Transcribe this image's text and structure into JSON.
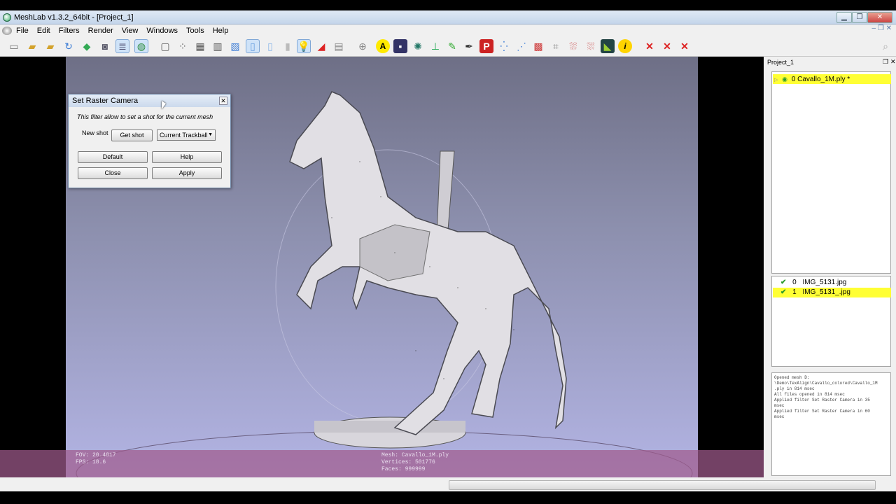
{
  "window": {
    "title": "MeshLab v1.3.2_64bit - [Project_1]"
  },
  "menu": [
    "File",
    "Edit",
    "Filters",
    "Render",
    "View",
    "Windows",
    "Tools",
    "Help"
  ],
  "dialog": {
    "title": "Set Raster Camera",
    "description": "This filter allow to set a shot for the current mesh",
    "new_shot_label": "New shot",
    "get_shot_label": "Get shot",
    "combo_value": "Current Trackball",
    "default_label": "Default",
    "help_label": "Help",
    "close_label": "Close",
    "apply_label": "Apply"
  },
  "viewport": {
    "fov": "FOV: 20.4817",
    "fps": "FPS:   18.6",
    "mesh": "Mesh: Cavallo_1M.ply",
    "vertices": "Vertices: 501776",
    "faces": "Faces: 999999"
  },
  "panel": {
    "title": "Project_1",
    "layers": [
      {
        "label": "0  Cavallo_1M.ply *",
        "selected": true
      }
    ],
    "rasters": [
      {
        "index": "0",
        "name": "IMG_5131.jpg",
        "selected": false
      },
      {
        "index": "1",
        "name": "IMG_5131_.jpg",
        "selected": true
      }
    ],
    "log": [
      "Opened mesh D:",
      "\\Demo\\TexAlign\\Cavallo_colored\\Cavallo_1M",
      ".ply in 814 msec",
      "All files opened in 814 msec",
      "Applied filter Set Raster Camera in 35",
      "msec",
      "Applied filter Set Raster Camera in 60",
      "msec"
    ]
  },
  "colors": {
    "selection": "#ffff34",
    "check": "#2a9a2a"
  }
}
